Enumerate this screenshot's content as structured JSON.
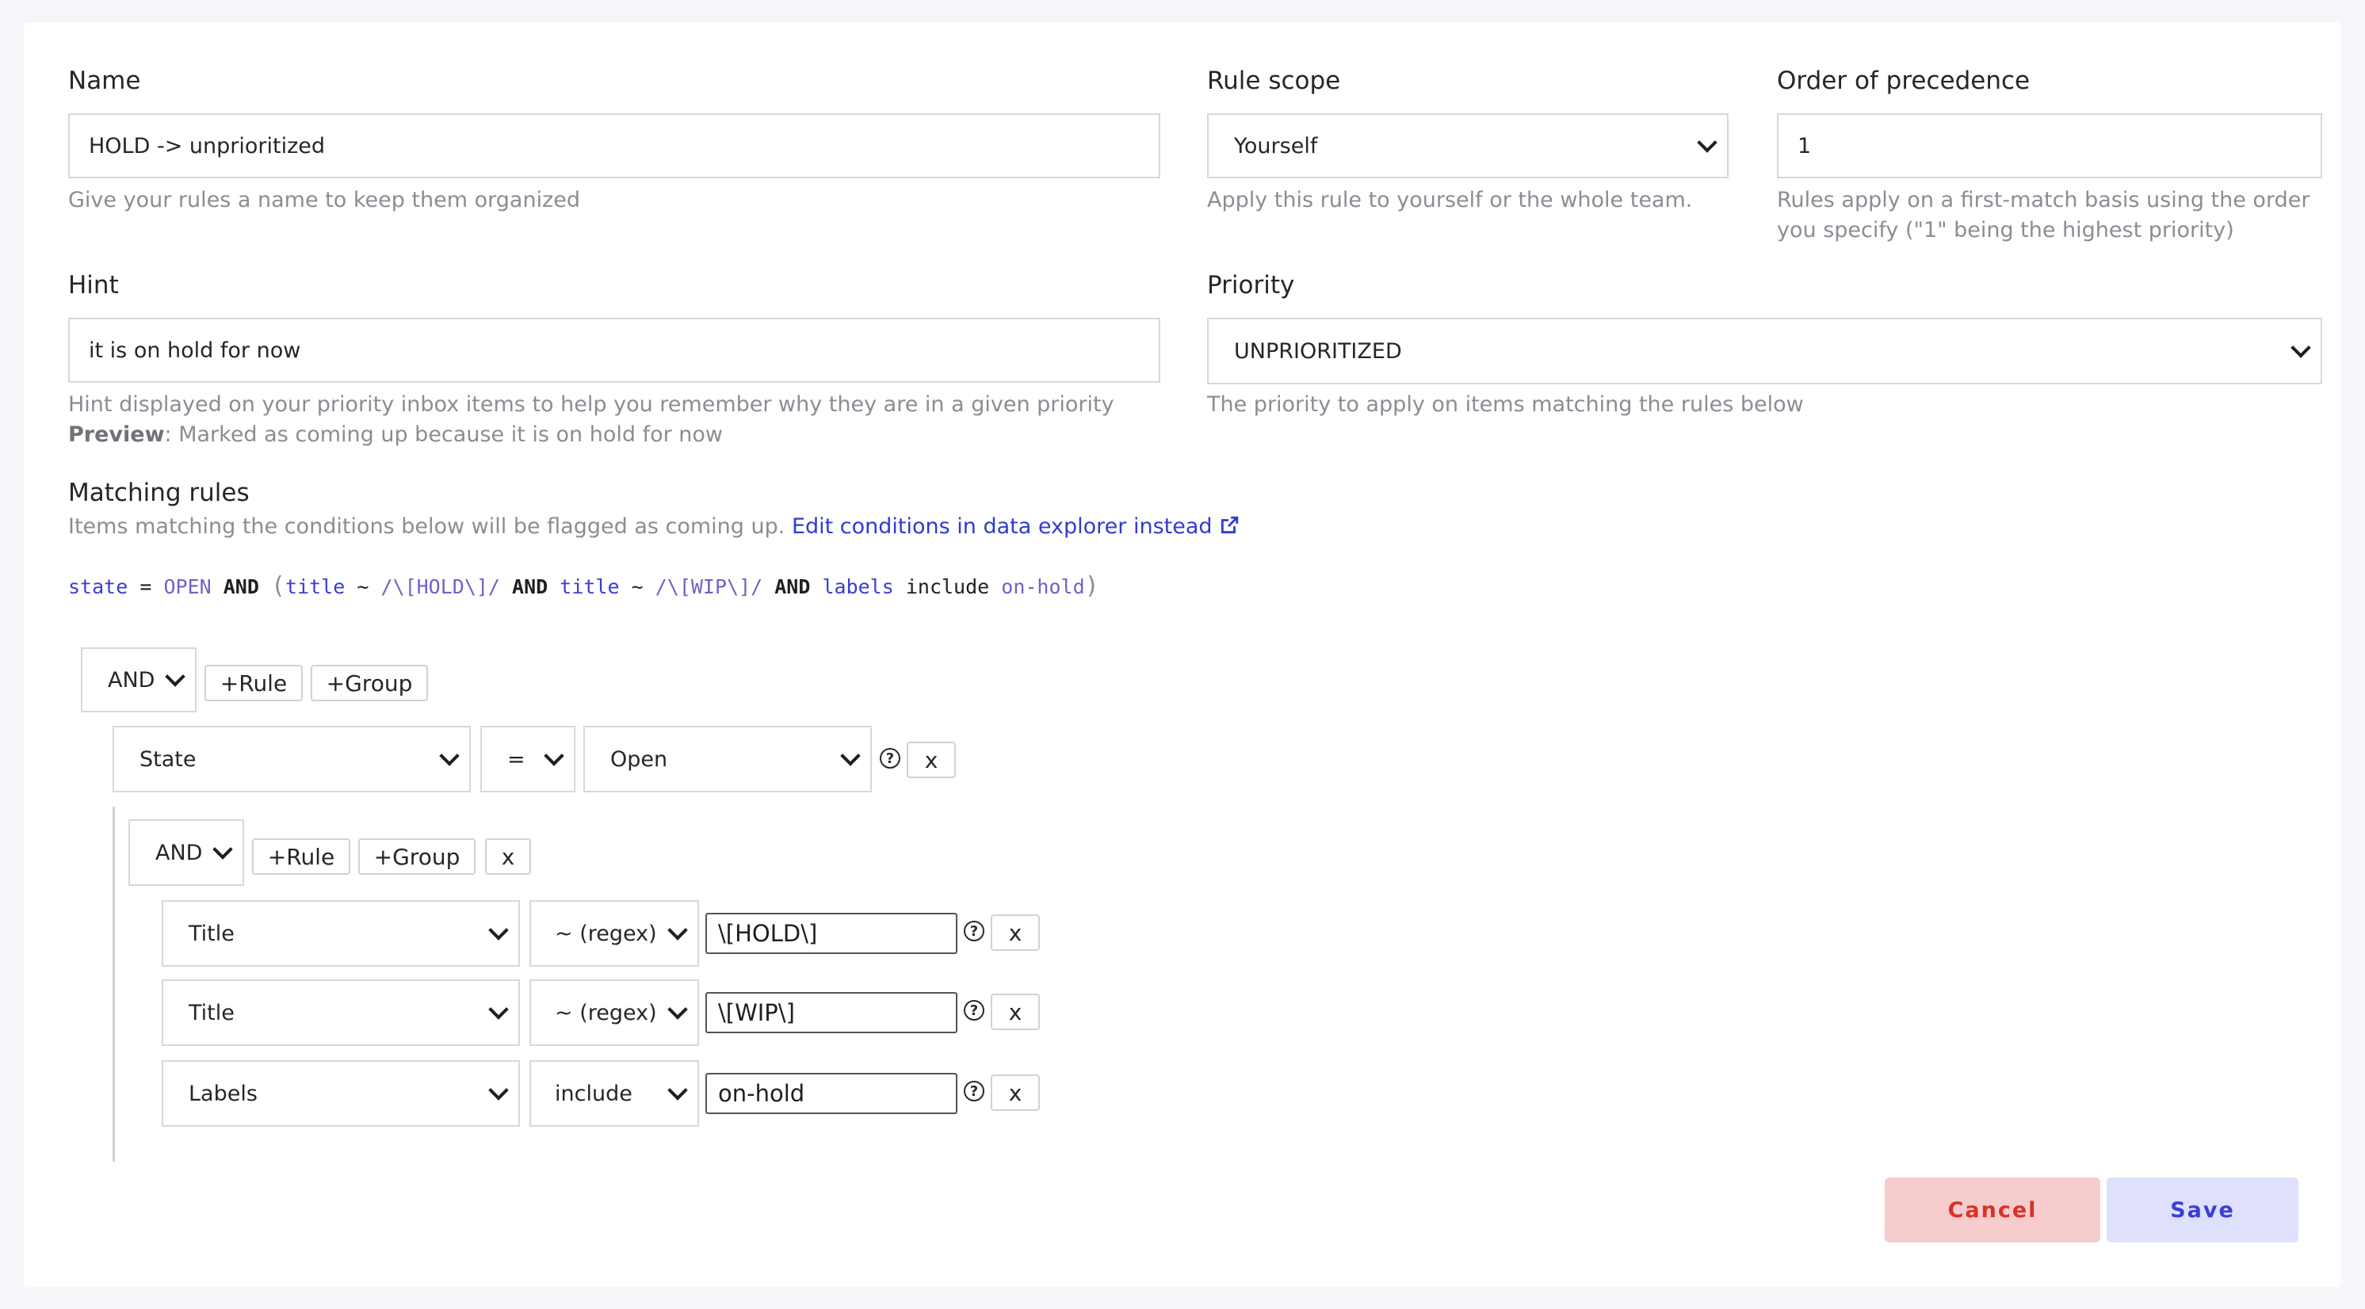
{
  "form": {
    "name": {
      "label": "Name",
      "value": "HOLD -> unprioritized",
      "help": "Give your rules a name to keep them organized"
    },
    "scope": {
      "label": "Rule scope",
      "value": "Yourself",
      "help": "Apply this rule to yourself or the whole team."
    },
    "order": {
      "label": "Order of precedence",
      "value": "1",
      "help_line1": "Rules apply on a first-match basis using the order",
      "help_line2": "you specify (\"1\" being the highest priority)"
    },
    "hint": {
      "label": "Hint",
      "value": "it is on hold for now",
      "help": "Hint displayed on your priority inbox items to help you remember why they are in a given priority",
      "preview_label": "Preview",
      "preview_text": ": Marked as coming up because it is on hold for now"
    },
    "priority": {
      "label": "Priority",
      "value": "UNPRIORITIZED",
      "help": "The priority to apply on items matching the rules below"
    }
  },
  "matching": {
    "title": "Matching rules",
    "description": "Items matching the conditions below will be flagged as coming up.",
    "link_text": "Edit conditions in data explorer instead",
    "query": {
      "f1": "state",
      "eq": "=",
      "v1": "OPEN",
      "and1": "AND",
      "lparen": "(",
      "f2": "title",
      "tilde1": "~",
      "v2": "/\\[HOLD\\]/",
      "and2": "AND",
      "f3": "title",
      "tilde2": "~",
      "v3": "/\\[WIP\\]/",
      "and3": "AND",
      "f4": "labels",
      "op4": "include",
      "v4": "on-hold",
      "rparen": ")"
    }
  },
  "builder": {
    "root": {
      "combinator": "AND",
      "add_rule": "+Rule",
      "add_group": "+Group",
      "rule": {
        "field": "State",
        "operator": "=",
        "value": "Open",
        "remove": "x"
      }
    },
    "subgroup": {
      "combinator": "AND",
      "add_rule": "+Rule",
      "add_group": "+Group",
      "remove": "x",
      "rules": [
        {
          "field": "Title",
          "operator": "~ (regex)",
          "value": "\\[HOLD\\]",
          "remove": "x"
        },
        {
          "field": "Title",
          "operator": "~ (regex)",
          "value": "\\[WIP\\]",
          "remove": "x"
        },
        {
          "field": "Labels",
          "operator": "include",
          "value": "on-hold",
          "remove": "x"
        }
      ]
    },
    "help_icon": "?"
  },
  "actions": {
    "cancel": "Cancel",
    "save": "Save"
  },
  "colors": {
    "cancel_bg": "#f6cccc",
    "cancel_text": "#d9312a",
    "save_bg": "#dfe0fb",
    "save_text": "#3a3fd1",
    "link": "#2f3ccf"
  }
}
